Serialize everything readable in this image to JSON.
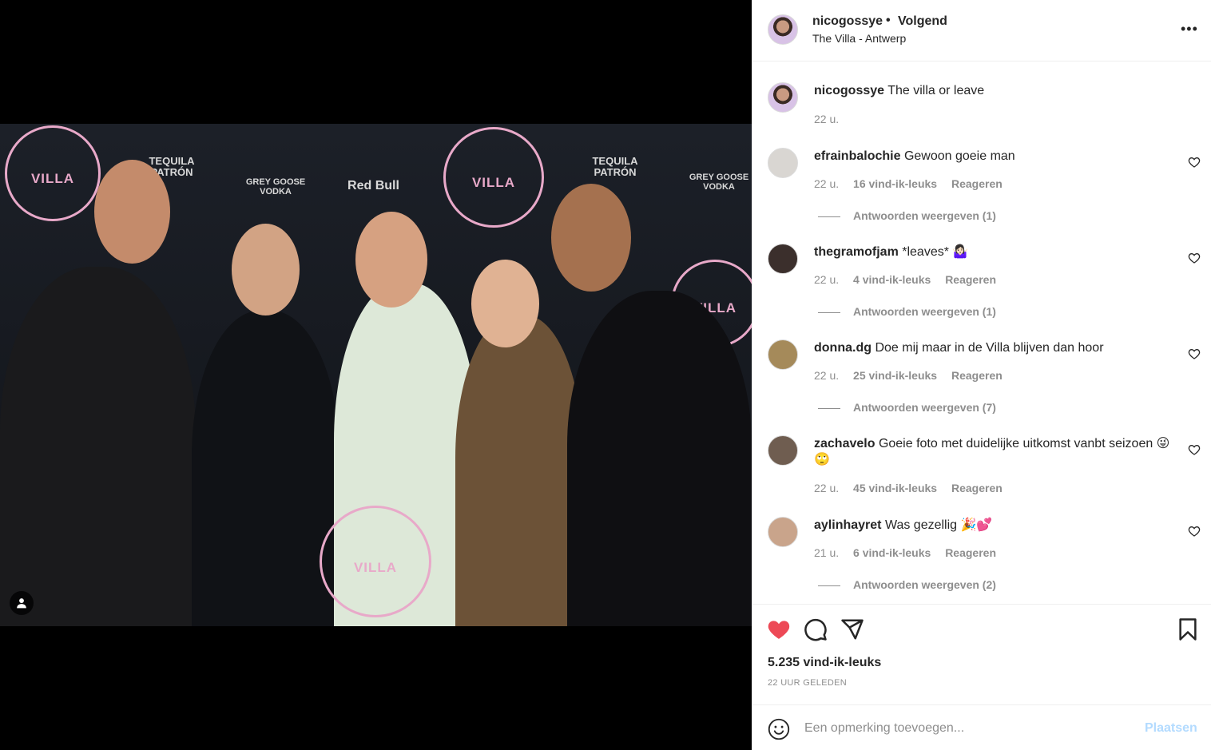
{
  "post": {
    "username": "nicogossye",
    "separator": "•",
    "follow_status": "Volgend",
    "location": "The Villa - Antwerp",
    "more_label": "•••"
  },
  "photo": {
    "backdrop": {
      "logo_text": "VILLA",
      "sponsors": [
        "TEQUILA PATRÓN",
        "GREY GOOSE VODKA",
        "Red Bull",
        "TEQUILA PATRÓN",
        "GREY GOOSE VODKA"
      ]
    }
  },
  "caption": {
    "username": "nicogossye",
    "text": "The villa or leave",
    "time": "22 u."
  },
  "comments": [
    {
      "username": "efrainbalochie",
      "text": "Gewoon goeie man",
      "time": "22 u.",
      "likes": "16 vind-ik-leuks",
      "reply": "Reageren",
      "view_replies": "Antwoorden weergeven (1)",
      "avatar_color": "#d9d6d2"
    },
    {
      "username": "thegramofjam",
      "text": "*leaves* 🤷🏻‍♀️",
      "time": "22 u.",
      "likes": "4 vind-ik-leuks",
      "reply": "Reageren",
      "view_replies": "Antwoorden weergeven (1)",
      "avatar_color": "#3b2f2c"
    },
    {
      "username": "donna.dg",
      "text": "Doe mij maar in de Villa blijven dan hoor",
      "time": "22 u.",
      "likes": "25 vind-ik-leuks",
      "reply": "Reageren",
      "view_replies": "Antwoorden weergeven (7)",
      "avatar_color": "#a58a5a"
    },
    {
      "username": "zachavelo",
      "text": "Goeie foto met duidelijke uitkomst vanbt seizoen 😜🙄",
      "time": "22 u.",
      "likes": "45 vind-ik-leuks",
      "reply": "Reageren",
      "view_replies": "",
      "avatar_color": "#6f5d50"
    },
    {
      "username": "aylinhayret",
      "text": "Was gezellig 🎉💕",
      "time": "21 u.",
      "likes": "6 vind-ik-leuks",
      "reply": "Reageren",
      "view_replies": "Antwoorden weergeven (2)",
      "avatar_color": "#c9a48b"
    }
  ],
  "actions": {
    "like_count": "5.235 vind-ik-leuks",
    "time_ago": "22 UUR GELEDEN",
    "liked": true,
    "like_color": "#ed4956"
  },
  "add_comment": {
    "placeholder": "Een opmerking toevoegen...",
    "post_label": "Plaatsen",
    "post_color": "#b3dbff"
  }
}
